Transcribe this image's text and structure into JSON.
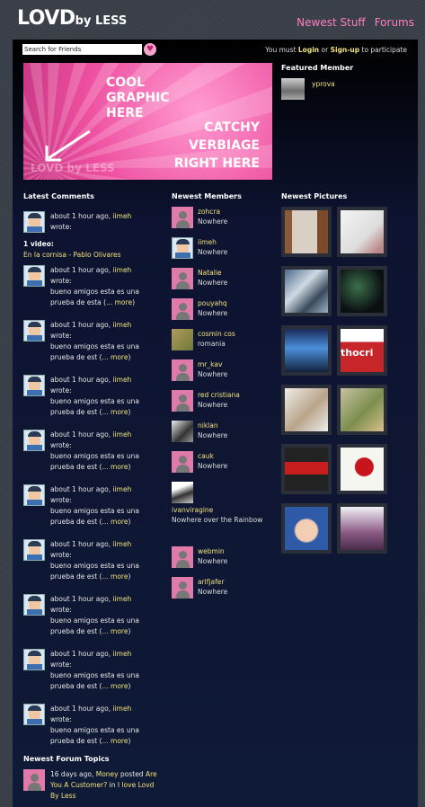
{
  "logo": {
    "main": "LOVD",
    "sub": "by LESS"
  },
  "topnav": {
    "newest_stuff": "Newest Stuff",
    "forums": "Forums"
  },
  "search": {
    "value": "Search for Friends"
  },
  "login_msg": {
    "prefix": "You must",
    "login": "Login",
    "or": "or",
    "signup": "Sign-up",
    "suffix": "to participate"
  },
  "banner": {
    "line1": "COOL",
    "line2": "GRAPHIC",
    "line3": "HERE",
    "line4": "CATCHY",
    "line5": "VERBIAGE",
    "line6": "RIGHT HERE",
    "watermark": "LOVD by LESS"
  },
  "featured": {
    "title": "Featured Member",
    "name": "yprova"
  },
  "latest_comments": {
    "title": "Latest Comments",
    "first": {
      "time": "about 1 hour ago,",
      "user": "iimeh",
      "wrote": "wrote:"
    },
    "video_label": "1 video:",
    "video_link": "En la cornisa - Pablo Olivares",
    "items": [
      {
        "time": "about 1 hour ago,",
        "user": "iimeh",
        "wrote": "wrote:",
        "text": "bueno amigos esta es una prueba de esta (",
        "more": "... more",
        "close": ")"
      },
      {
        "time": "about 1 hour ago,",
        "user": "iimeh",
        "wrote": "wrote:",
        "text": "bueno amigos esta es una prueba de est (",
        "more": "... more",
        "close": ")"
      },
      {
        "time": "about 1 hour ago,",
        "user": "iimeh",
        "wrote": "wrote:",
        "text": "bueno amigos esta es una prueba de est (",
        "more": "... more",
        "close": ")"
      },
      {
        "time": "about 1 hour ago,",
        "user": "iimeh",
        "wrote": "wrote:",
        "text": "bueno amigos esta es una prueba de est (",
        "more": "... more",
        "close": ")"
      },
      {
        "time": "about 1 hour ago,",
        "user": "iimeh",
        "wrote": "wrote:",
        "text": "bueno amigos esta es una prueba de est (",
        "more": "... more",
        "close": ")"
      },
      {
        "time": "about 1 hour ago,",
        "user": "iimeh",
        "wrote": "wrote:",
        "text": "bueno amigos esta es una prueba de est (",
        "more": "... more",
        "close": ")"
      },
      {
        "time": "about 1 hour ago,",
        "user": "iimeh",
        "wrote": "wrote:",
        "text": "bueno amigos esta es una prueba de est (",
        "more": "... more",
        "close": ")"
      },
      {
        "time": "about 1 hour ago,",
        "user": "iimeh",
        "wrote": "wrote:",
        "text": "bueno amigos esta es una prueba de est (",
        "more": "... more",
        "close": ")"
      },
      {
        "time": "about 1 hour ago,",
        "user": "iimeh",
        "wrote": "wrote:",
        "text": "bueno amigos esta es una prueba de est (",
        "more": "... more",
        "close": ")"
      }
    ]
  },
  "newest_members": {
    "title": "Newest Members",
    "items": [
      {
        "name": "zohcra",
        "loc": "Nowhere"
      },
      {
        "name": "iimeh",
        "loc": "Nowhere"
      },
      {
        "name": "Natalie",
        "loc": "Nowhere"
      },
      {
        "name": "pouyahq",
        "loc": "Nowhere"
      },
      {
        "name": "cosmin cos",
        "loc": "romania"
      },
      {
        "name": "mr_kav",
        "loc": "Nowhere"
      },
      {
        "name": "red cristiana",
        "loc": "Nowhere"
      },
      {
        "name": "niklan",
        "loc": "Nowhere"
      },
      {
        "name": "cauk",
        "loc": "Nowhere"
      },
      {
        "name": "ivanviragine",
        "loc": "Nowhere over the Rainbow"
      },
      {
        "name": "webmin",
        "loc": "Nowhere"
      },
      {
        "name": "arifjafer",
        "loc": "Nowhere"
      }
    ]
  },
  "newest_pictures": {
    "title": "Newest Pictures",
    "overlay_text": "thocri"
  },
  "forum_topics": {
    "title": "Newest Forum Topics",
    "time": "16 days ago,",
    "user": "Money",
    "posted": "posted",
    "topic": "Are You A Customer?",
    "in": "in",
    "forum": "I love Lovd By Less"
  },
  "colors": {
    "accent_pink": "#ff7dc0",
    "link_yellow": "#f2e27c",
    "panel_bg": "#0b1128"
  }
}
